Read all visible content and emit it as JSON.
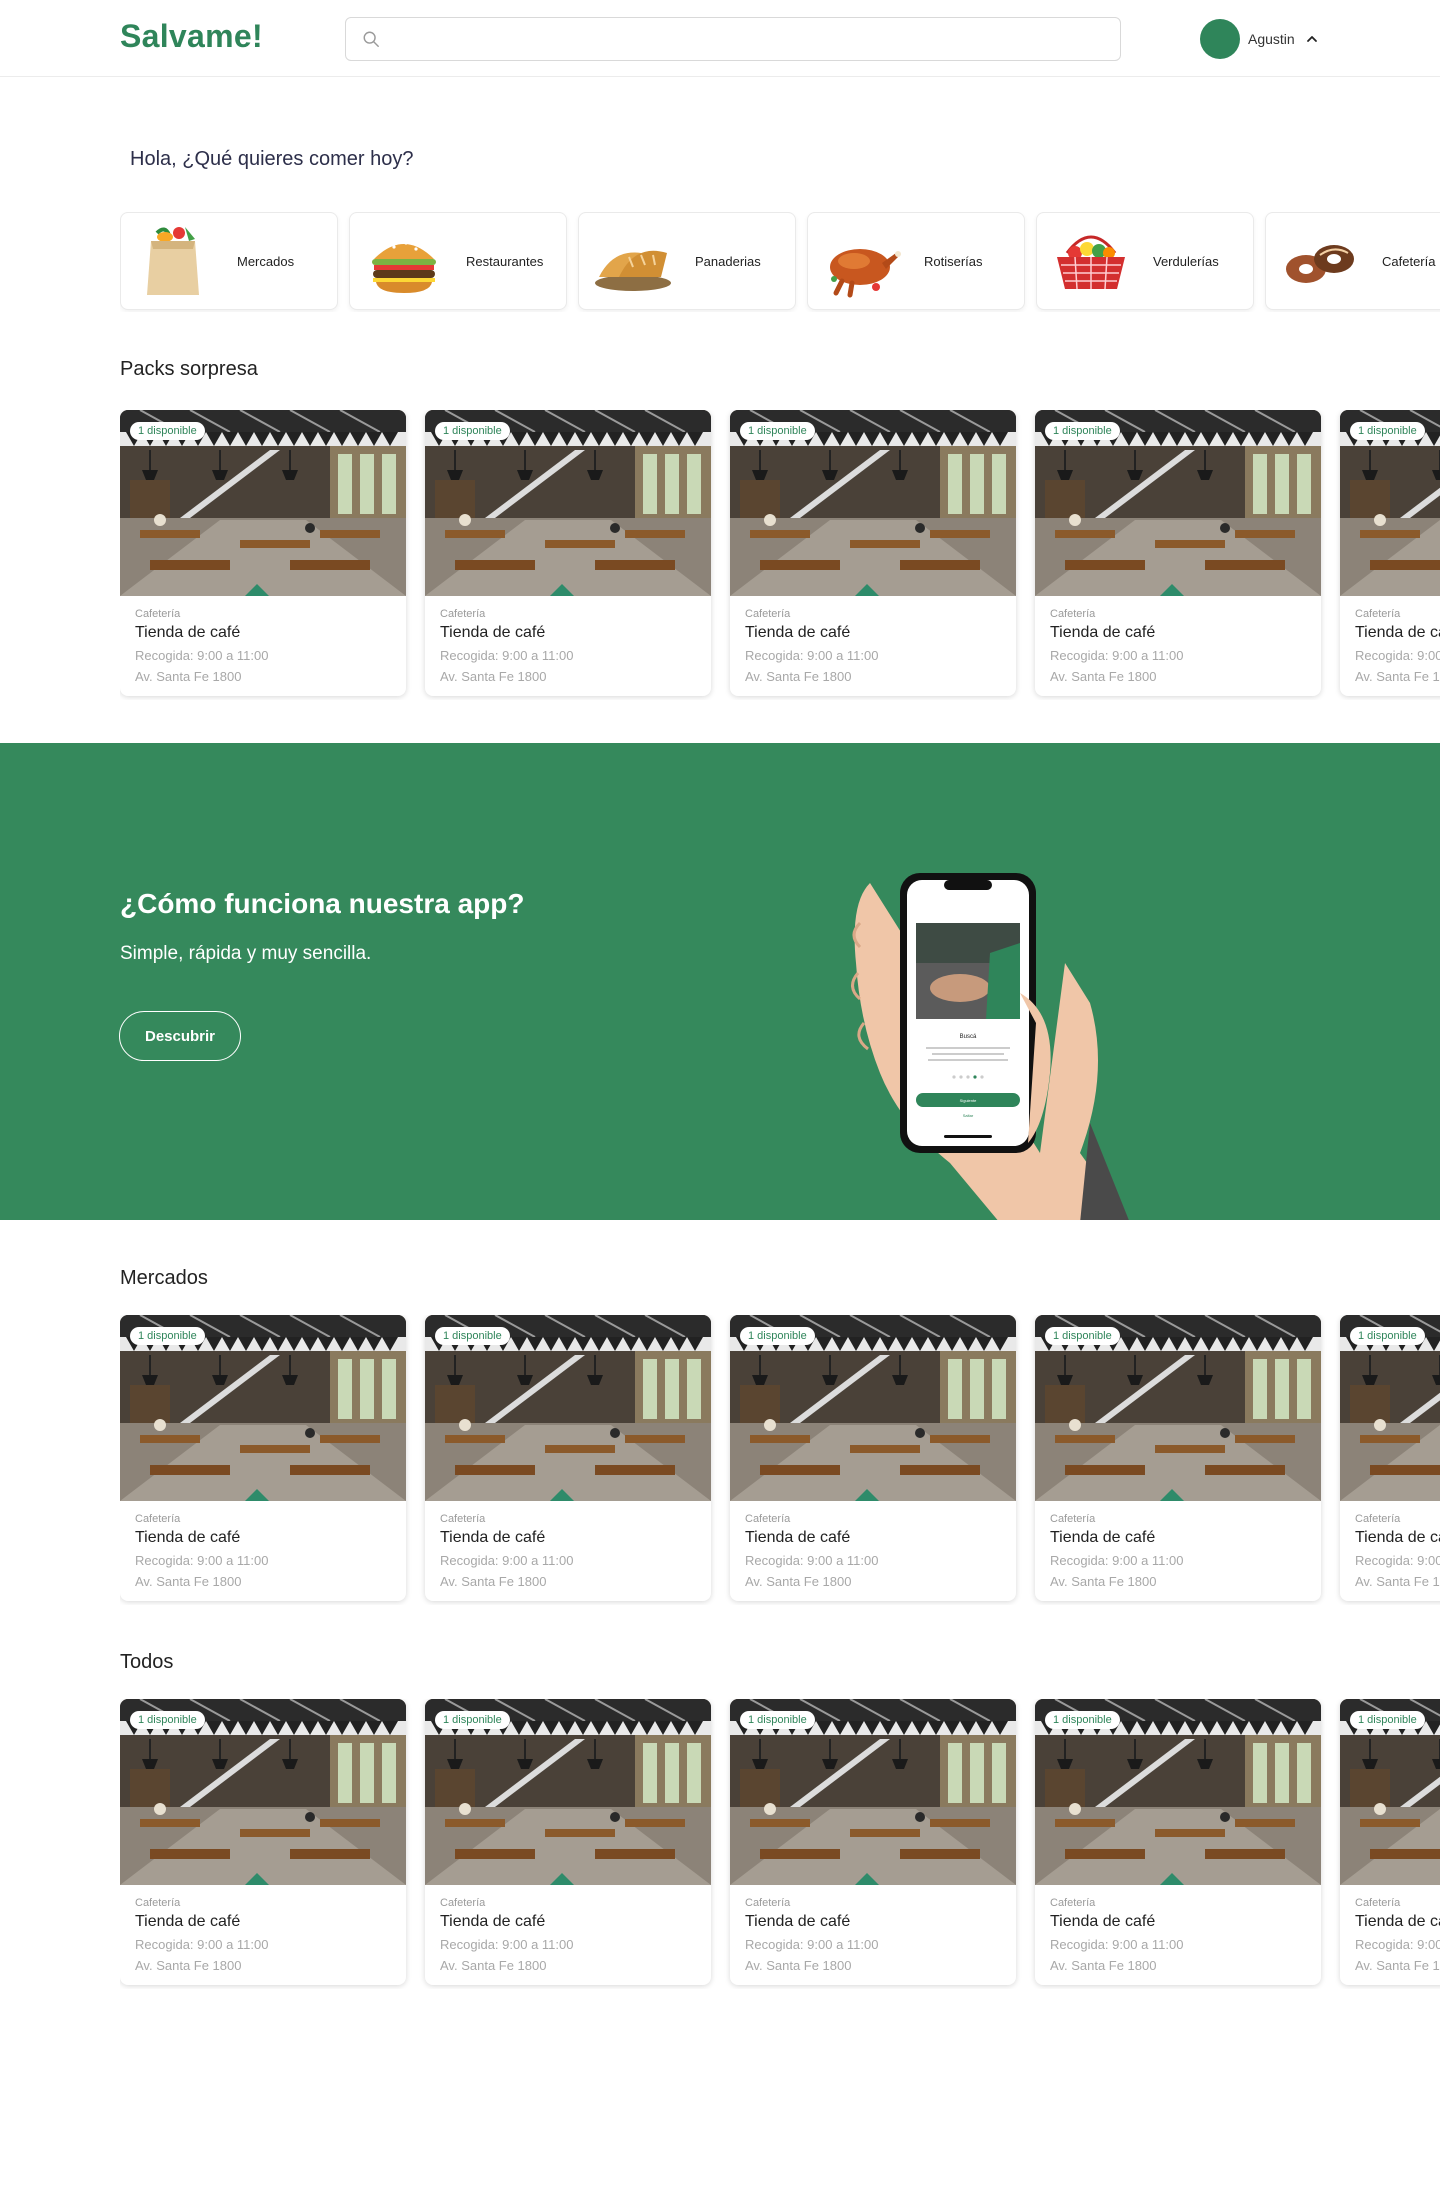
{
  "header": {
    "logo": "Salvame!",
    "search_value": "",
    "user_name": "Agustin"
  },
  "greeting": "Hola, ¿Qué quieres comer hoy?",
  "categories": [
    {
      "label": "Mercados",
      "icon": "grocery-bag-icon"
    },
    {
      "label": "Restaurantes",
      "icon": "burger-icon"
    },
    {
      "label": "Panaderias",
      "icon": "bread-icon"
    },
    {
      "label": "Rotiserías",
      "icon": "roast-chicken-icon"
    },
    {
      "label": "Verdulerías",
      "icon": "vegetable-basket-icon"
    },
    {
      "label": "Cafetería",
      "icon": "pastry-icon"
    }
  ],
  "card": {
    "badge": "1 disponible",
    "category": "Cafetería",
    "name": "Tienda de café",
    "pickup": "Recogida: 9:00 a 11:00",
    "address": "Av. Santa Fe 1800"
  },
  "sections": {
    "packs": "Packs sorpresa",
    "mercados": "Mercados",
    "todos": "Todos"
  },
  "promo": {
    "title": "¿Cómo funciona nuestra app?",
    "subtitle": "Simple, rápida y muy sencilla.",
    "button": "Descubrir",
    "phone": {
      "heading": "Buscá",
      "next": "Siguiente",
      "skip": "Saltar"
    }
  },
  "colors": {
    "brand": "#2f855a",
    "banner": "#35895c"
  }
}
